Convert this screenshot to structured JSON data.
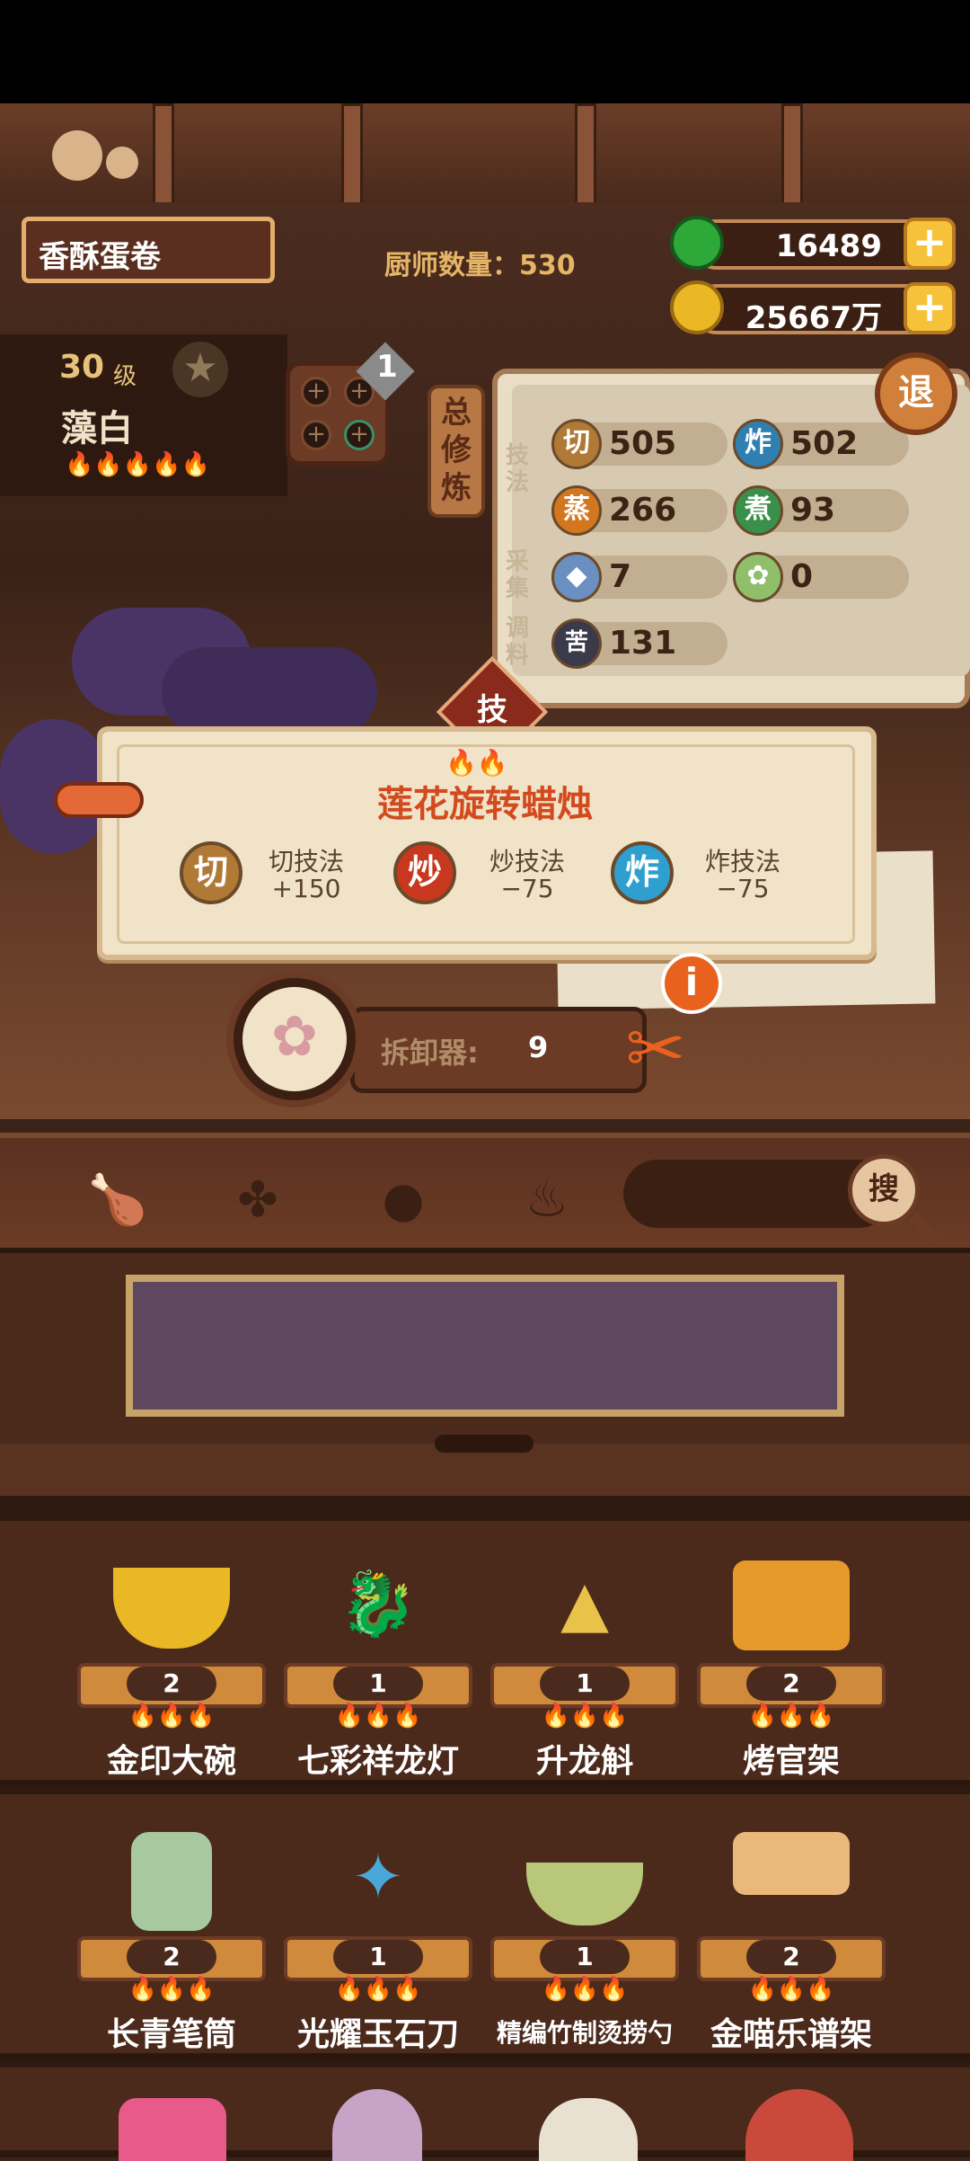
{
  "dish": {
    "name": "香酥蛋卷"
  },
  "chef_count": {
    "label": "厨师数量：530"
  },
  "currencies": [
    {
      "name": "jade",
      "value": "16489",
      "icon": "jade-icon",
      "color": "#2fa83a"
    },
    {
      "name": "coins",
      "value": "25667万",
      "icon": "coin-icon",
      "color": "#e9b824"
    }
  ],
  "exit_button": {
    "label": "退"
  },
  "chef": {
    "level": "30",
    "level_unit": "级",
    "name": "藻白",
    "stars": "🔥🔥🔥🔥🔥"
  },
  "equip_slot": {
    "count": "1"
  },
  "training_tab": {
    "label": "总修炼"
  },
  "skills": {
    "section_labels": {
      "technique": "技法",
      "gather": "采集",
      "seasoning": "调料"
    },
    "stats": [
      {
        "icon_text": "切",
        "value": "505",
        "color": "#b07a36"
      },
      {
        "icon_text": "炸",
        "value": "502",
        "color": "#2f7fb0"
      },
      {
        "icon_text": "蒸",
        "value": "266",
        "color": "#d2771e"
      },
      {
        "icon_text": "煮",
        "value": "93",
        "color": "#3a8f4a"
      },
      {
        "icon_text": "",
        "value": "7",
        "color": "#6b8fc0",
        "icon": "fish-icon"
      },
      {
        "icon_text": "",
        "value": "0",
        "color": "#8fbf6a",
        "icon": "cabbage-icon"
      },
      {
        "icon_text": "苦",
        "value": "131",
        "color": "#3a3a4a"
      }
    ]
  },
  "tech_tab": {
    "label": "技"
  },
  "tooltip": {
    "fire": "🔥🔥",
    "title": "莲花旋转蜡烛",
    "effects": [
      {
        "icon_text": "切",
        "name": "切技法",
        "value": "+150",
        "color": "#b07a36"
      },
      {
        "icon_text": "炒",
        "name": "炒技法",
        "value": "−75",
        "color": "#c7381e"
      },
      {
        "icon_text": "炸",
        "name": "炸技法",
        "value": "−75",
        "color": "#2f9fd0"
      }
    ]
  },
  "background_note": {
    "percent": "%"
  },
  "disassembler": {
    "label": "拆卸器:",
    "count": "9"
  },
  "info_button": {
    "label": "i"
  },
  "filters": [
    {
      "icon": "drumstick-icon"
    },
    {
      "icon": "pouch-icon"
    },
    {
      "icon": "pan-icon"
    },
    {
      "icon": "flame-icon"
    }
  ],
  "search": {
    "button_label": "搜",
    "placeholder": ""
  },
  "items": [
    {
      "name": "金印大碗",
      "count": "2",
      "fire": "🔥🔥🔥",
      "icon": "golden-bowl-icon"
    },
    {
      "name": "七彩祥龙灯",
      "count": "1",
      "fire": "🔥🔥🔥",
      "icon": "dragon-lantern-icon"
    },
    {
      "name": "升龙斛",
      "count": "1",
      "fire": "🔥🔥🔥",
      "icon": "dragon-vessel-icon"
    },
    {
      "name": "烤官架",
      "count": "2",
      "fire": "🔥🔥🔥",
      "icon": "roast-rack-icon"
    },
    {
      "name": "长青笔筒",
      "count": "2",
      "fire": "🔥🔥🔥",
      "icon": "brush-holder-icon"
    },
    {
      "name": "光耀玉石刀",
      "count": "1",
      "fire": "🔥🔥🔥",
      "icon": "jade-knife-icon"
    },
    {
      "name": "精编竹制烫捞勺",
      "count": "1",
      "fire": "🔥🔥🔥",
      "icon": "bamboo-ladle-icon"
    },
    {
      "name": "金喵乐谱架",
      "count": "2",
      "fire": "🔥🔥🔥",
      "icon": "music-stand-icon"
    }
  ]
}
